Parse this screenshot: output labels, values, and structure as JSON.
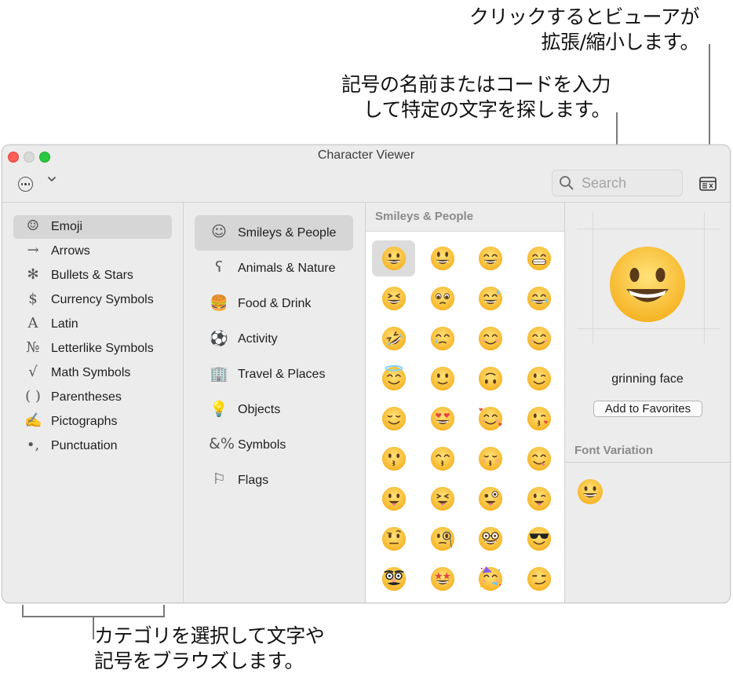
{
  "callouts": {
    "viewer_toggle_line1": "クリックするとビューアが",
    "viewer_toggle_line2": "拡張/縮小します。",
    "search_line1": "記号の名前またはコードを入力",
    "search_line2": "して特定の文字を探します。",
    "browse_line1": "カテゴリを選択して文字や",
    "browse_line2": "記号をブラウズします。"
  },
  "window": {
    "title": "Character Viewer",
    "search_placeholder": "Search"
  },
  "sidebar": {
    "items": [
      {
        "label": "Emoji",
        "icon": "smiley-icon",
        "glyph": "☺",
        "selected": true
      },
      {
        "label": "Arrows",
        "icon": "arrow-icon",
        "glyph": "→",
        "selected": false
      },
      {
        "label": "Bullets & Stars",
        "icon": "asterisk-icon",
        "glyph": "✻",
        "selected": false
      },
      {
        "label": "Currency Symbols",
        "icon": "dollar-icon",
        "glyph": "$",
        "selected": false
      },
      {
        "label": "Latin",
        "icon": "latin-a-icon",
        "glyph": "A",
        "selected": false
      },
      {
        "label": "Letterlike Symbols",
        "icon": "numero-icon",
        "glyph": "№",
        "selected": false
      },
      {
        "label": "Math Symbols",
        "icon": "radical-icon",
        "glyph": "√",
        "selected": false
      },
      {
        "label": "Parentheses",
        "icon": "parentheses-icon",
        "glyph": "( )",
        "selected": false
      },
      {
        "label": "Pictographs",
        "icon": "pen-icon",
        "glyph": "✍",
        "selected": false
      },
      {
        "label": "Punctuation",
        "icon": "punctuation-icon",
        "glyph": "•,",
        "selected": false
      }
    ]
  },
  "categories": {
    "items": [
      {
        "label": "Smileys & People",
        "icon": "smiley-outline-icon",
        "glyph": "☺",
        "selected": true
      },
      {
        "label": "Animals & Nature",
        "icon": "bear-icon",
        "glyph": "ʕ",
        "selected": false
      },
      {
        "label": "Food & Drink",
        "icon": "burger-cup-icon",
        "glyph": "🍔",
        "selected": false
      },
      {
        "label": "Activity",
        "icon": "soccer-ball-icon",
        "glyph": "⚽",
        "selected": false
      },
      {
        "label": "Travel & Places",
        "icon": "building-car-icon",
        "glyph": "🏢",
        "selected": false
      },
      {
        "label": "Objects",
        "icon": "lightbulb-icon",
        "glyph": "💡",
        "selected": false
      },
      {
        "label": "Symbols",
        "icon": "symbols-icon",
        "glyph": "&%",
        "selected": false
      },
      {
        "label": "Flags",
        "icon": "flag-icon",
        "glyph": "⚐",
        "selected": false
      }
    ]
  },
  "grid": {
    "header": "Smileys & People",
    "emoji": [
      "grinning",
      "smiley",
      "smile",
      "grin",
      "laughing",
      "holding-back-tears",
      "sweat-smile",
      "joy",
      "rofl",
      "face-with-tear",
      "relaxed",
      "blush",
      "innocent",
      "slightly-smiling",
      "upside-down",
      "wink",
      "relieved",
      "heart-eyes",
      "smiling-hearts",
      "kissing-heart",
      "kissing",
      "kissing-smiling-eyes",
      "kissing-closed-eyes",
      "yum",
      "tongue",
      "squinting-tongue",
      "zany",
      "winking-tongue",
      "raised-eyebrow",
      "monocle",
      "nerd",
      "sunglasses",
      "disguised",
      "star-struck",
      "partying",
      "smirk"
    ],
    "selected_index": 0
  },
  "detail": {
    "name": "grinning face",
    "favorites_button": "Add to Favorites",
    "font_variation_header": "Font Variation"
  }
}
